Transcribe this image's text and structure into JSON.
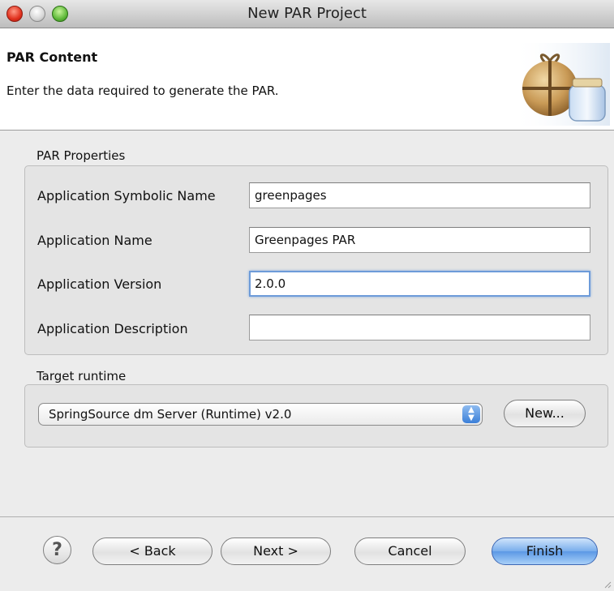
{
  "window": {
    "title": "New PAR Project"
  },
  "header": {
    "title": "PAR Content",
    "description": "Enter the data required to generate the PAR.",
    "graphic_icon": "par-bundle-icon"
  },
  "par_properties": {
    "label": "PAR Properties",
    "fields": [
      {
        "label": "Application Symbolic Name",
        "value": "greenpages"
      },
      {
        "label": "Application Name",
        "value": "Greenpages PAR"
      },
      {
        "label": "Application Version",
        "value": "2.0.0"
      },
      {
        "label": "Application Description",
        "value": ""
      }
    ]
  },
  "target_runtime": {
    "label": "Target runtime",
    "selected": "SpringSource dm Server (Runtime) v2.0",
    "new_button": "New..."
  },
  "buttons": {
    "help": "?",
    "back": "< Back",
    "next": "Next >",
    "cancel": "Cancel",
    "finish": "Finish"
  },
  "colors": {
    "accent": "#5b98e5",
    "close": "#e0301d",
    "maximize": "#5fb93a",
    "focus_ring": "#6d9bd9"
  }
}
